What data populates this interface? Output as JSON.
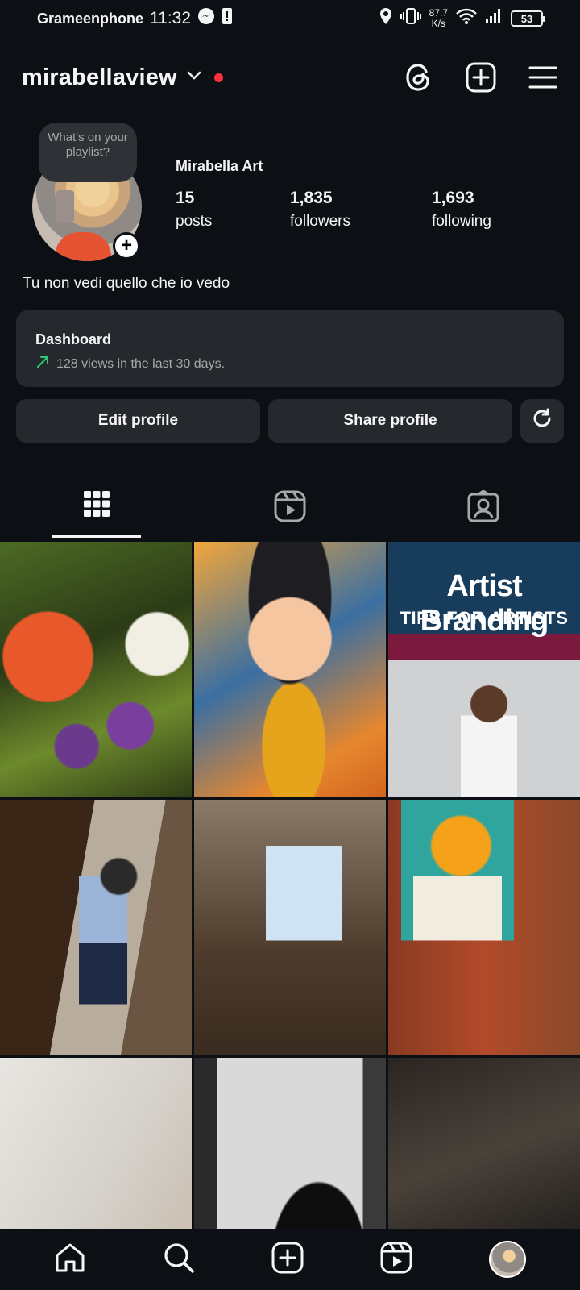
{
  "status_bar": {
    "carrier": "Grameenphone",
    "time": "11:32",
    "net_speed_value": "87.7",
    "net_speed_unit": "K/s",
    "battery": "53"
  },
  "header": {
    "username": "mirabellaview"
  },
  "profile": {
    "note": "What's on your playlist?",
    "display_name": "Mirabella Art",
    "posts_count": "15",
    "posts_label": "posts",
    "followers_count": "1,835",
    "followers_label": "followers",
    "following_count": "1,693",
    "following_label": "following",
    "bio": "Tu non vedi quello che io vedo"
  },
  "dashboard": {
    "title": "Dashboard",
    "subtitle": "128 views in the last 30 days."
  },
  "buttons": {
    "edit": "Edit profile",
    "share": "Share profile"
  },
  "grid": {
    "post3_title": "Artist Branding",
    "post3_subtitle": "TIPS FOR ARTISTS"
  },
  "colors": {
    "background": "#0c1014",
    "card": "#25292e",
    "notification_dot": "#ff3040",
    "trend_up": "#2ecc71"
  }
}
